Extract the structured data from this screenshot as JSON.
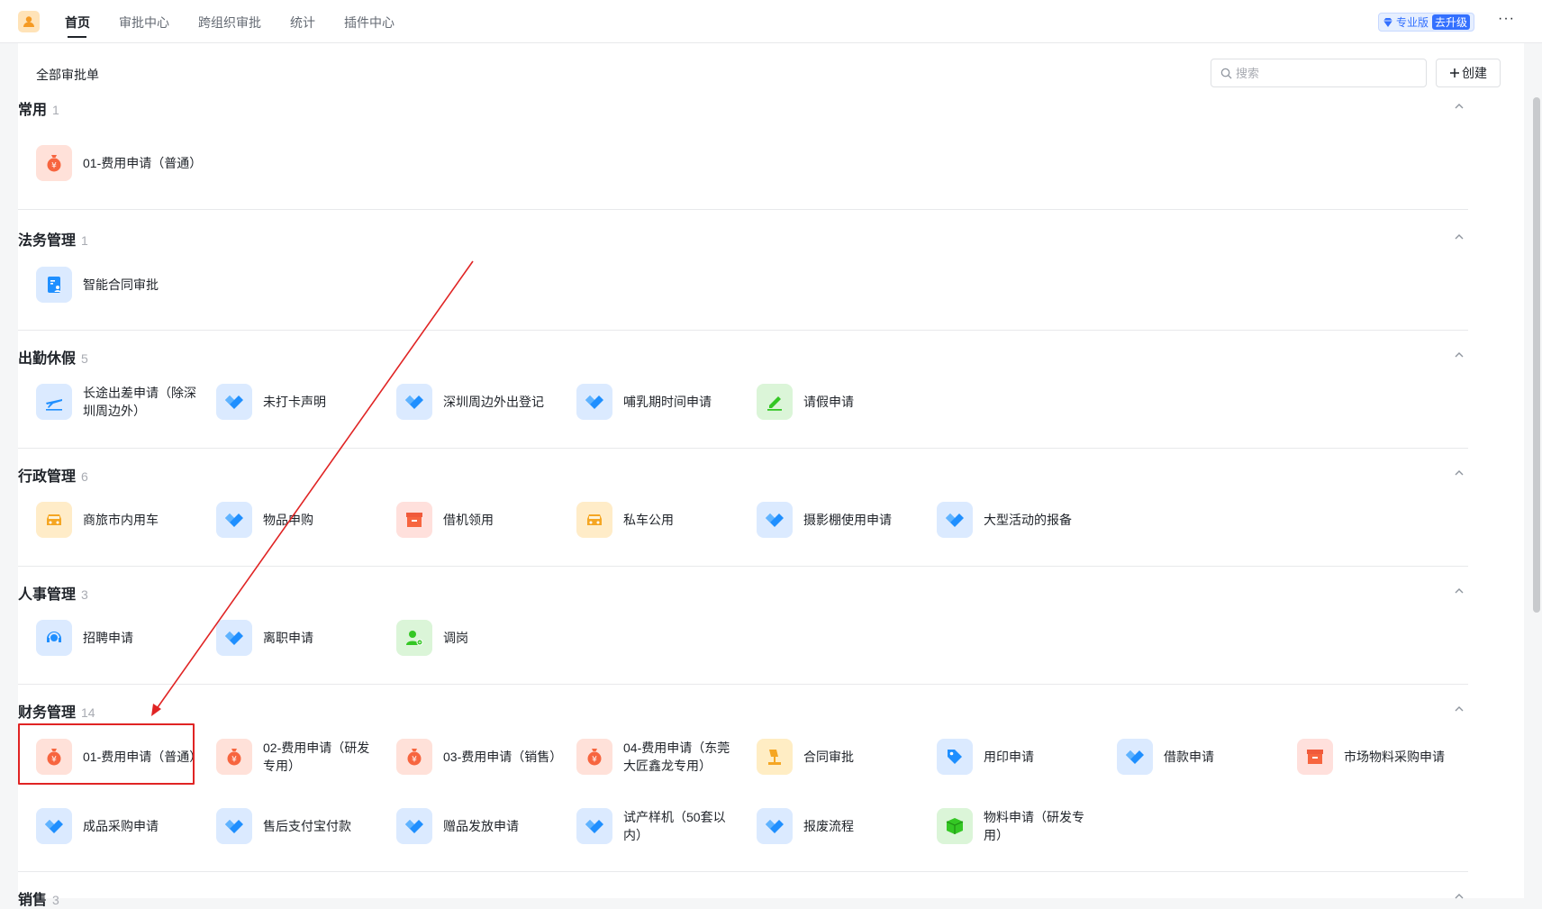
{
  "nav": {
    "items": [
      "首页",
      "审批中心",
      "跨组织审批",
      "统计",
      "插件中心"
    ],
    "badge_label": "专业版",
    "badge_upgrade": "去升级",
    "more": "···"
  },
  "header": {
    "title": "全部审批单",
    "search_placeholder": "搜索",
    "create_label": "创建"
  },
  "sections": [
    {
      "title": "常用",
      "count": "1",
      "apps": [
        "01-费用申请（普通）"
      ]
    },
    {
      "title": "法务管理",
      "count": "1",
      "apps": [
        "智能合同审批"
      ]
    },
    {
      "title": "出勤休假",
      "count": "5",
      "apps": [
        "长途出差申请（除深圳周边外）",
        "未打卡声明",
        "深圳周边外出登记",
        "哺乳期时间申请",
        "请假申请"
      ]
    },
    {
      "title": "行政管理",
      "count": "6",
      "apps": [
        "商旅市内用车",
        "物品申购",
        "借机领用",
        "私车公用",
        "摄影棚使用申请",
        "大型活动的报备"
      ]
    },
    {
      "title": "人事管理",
      "count": "3",
      "apps": [
        "招聘申请",
        "离职申请",
        "调岗"
      ]
    },
    {
      "title": "财务管理",
      "count": "14",
      "apps": [
        "01-费用申请（普通）",
        "02-费用申请（研发专用）",
        "03-费用申请（销售）",
        "04-费用申请（东莞大匠鑫龙专用）",
        "合同审批",
        "用印申请",
        "借款申请",
        "市场物料采购申请",
        "成品采购申请",
        "售后支付宝付款",
        "赠品发放申请",
        "试产样机（50套以内）",
        "报废流程",
        "物料申请（研发专用）"
      ]
    },
    {
      "title": "销售",
      "count": "3",
      "apps": []
    }
  ],
  "colors": {
    "accent": "#3370ff",
    "highlight": "#e02424",
    "money_icon": "#f7653f",
    "flow_icon": "#1f8fff"
  }
}
